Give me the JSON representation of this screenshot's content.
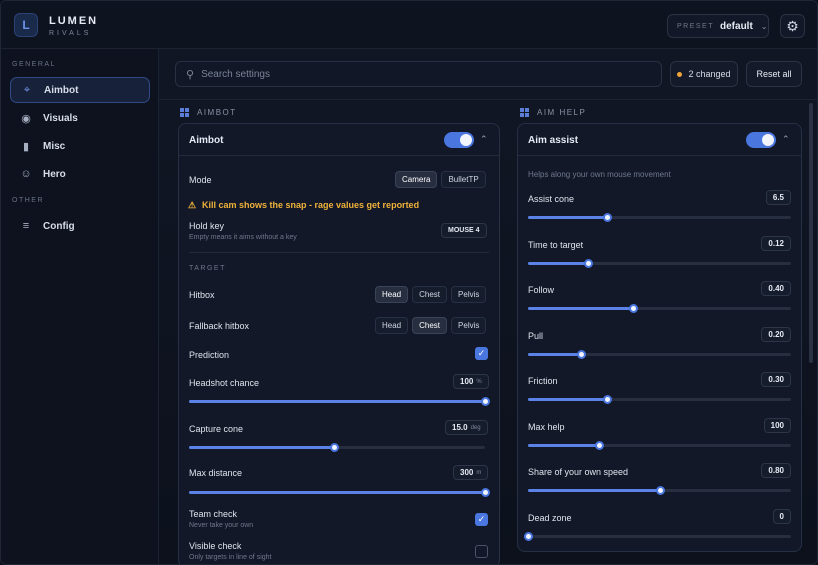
{
  "app": {
    "title": "LUMEN",
    "subtitle": "RIVALS"
  },
  "preset": {
    "label": "PRESET",
    "value": "default"
  },
  "sidebar": {
    "sections": [
      "GENERAL",
      "OTHER"
    ],
    "items": [
      {
        "label": "Aimbot",
        "icon": "crosshair-icon",
        "active": true
      },
      {
        "label": "Visuals",
        "icon": "eye-icon"
      },
      {
        "label": "Misc",
        "icon": "bars-icon"
      },
      {
        "label": "Hero",
        "icon": "person-icon"
      },
      {
        "label": "Config",
        "icon": "menu-icon"
      }
    ]
  },
  "search": {
    "placeholder": "Search settings"
  },
  "changed": {
    "label": "2 changed"
  },
  "reset": {
    "label": "Reset all"
  },
  "aimbot_section": {
    "heading": "AIMBOT",
    "card_title": "Aimbot",
    "enabled": true,
    "mode": {
      "label": "Mode",
      "options": [
        "Camera",
        "BulletTP"
      ],
      "selected": "Camera"
    },
    "warning": "Kill cam shows the snap - rage values get reported",
    "hold_key": {
      "label": "Hold key",
      "sub": "Empty means it aims without a key",
      "value": "MOUSE 4"
    },
    "target_heading": "TARGET",
    "hitbox": {
      "label": "Hitbox",
      "options": [
        "Head",
        "Chest",
        "Pelvis"
      ],
      "selected": "Head"
    },
    "fallback_hitbox": {
      "label": "Fallback hitbox",
      "options": [
        "Head",
        "Chest",
        "Pelvis"
      ],
      "selected": "Chest"
    },
    "prediction": {
      "label": "Prediction",
      "checked": true
    },
    "headshot_chance": {
      "label": "Headshot chance",
      "value": "100",
      "unit": "%",
      "fraction": 1.0
    },
    "capture_cone": {
      "label": "Capture cone",
      "value": "15.0",
      "unit": "deg",
      "fraction": 0.49
    },
    "max_distance": {
      "label": "Max distance",
      "value": "300",
      "unit": "m",
      "fraction": 1.0
    },
    "team_check": {
      "label": "Team check",
      "sub": "Never take your own",
      "checked": true
    },
    "visible_check": {
      "label": "Visible check",
      "sub": "Only targets in line of sight",
      "checked": false
    }
  },
  "aimhelp_section": {
    "heading": "AIM HELP",
    "card_title": "Aim assist",
    "enabled": true,
    "description": "Helps along your own mouse movement",
    "sliders": [
      {
        "label": "Assist cone",
        "value": "6.5",
        "fraction": 0.3
      },
      {
        "label": "Time to target",
        "value": "0.12",
        "fraction": 0.23
      },
      {
        "label": "Follow",
        "value": "0.40",
        "fraction": 0.4
      },
      {
        "label": "Pull",
        "value": "0.20",
        "fraction": 0.2
      },
      {
        "label": "Friction",
        "value": "0.30",
        "fraction": 0.3
      },
      {
        "label": "Max help",
        "value": "100",
        "fraction": 0.27
      },
      {
        "label": "Share of your own speed",
        "value": "0.80",
        "fraction": 0.5
      },
      {
        "label": "Dead zone",
        "value": "0",
        "fraction": 0.0
      }
    ]
  },
  "colors": {
    "accent": "#4a76e0",
    "warning": "#f0b23a",
    "background": "#0c111c"
  }
}
